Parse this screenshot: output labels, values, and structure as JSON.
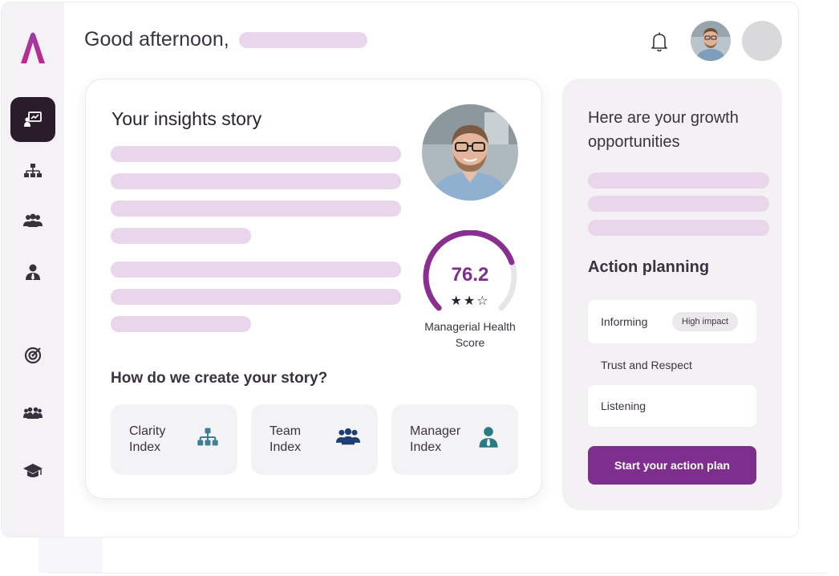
{
  "header": {
    "greeting": "Good afternoon,"
  },
  "nav": {
    "items": [
      {
        "icon": "dashboard-presentation-icon",
        "active": true
      },
      {
        "icon": "org-chart-icon",
        "active": false
      },
      {
        "icon": "team-icon",
        "active": false
      },
      {
        "icon": "manager-icon",
        "active": false
      },
      {
        "icon": "target-icon",
        "active": false
      },
      {
        "icon": "group-icon",
        "active": false
      },
      {
        "icon": "graduation-cap-icon",
        "active": false
      }
    ]
  },
  "insights": {
    "title": "Your insights story",
    "score_value": "76.2",
    "score_rating": 2,
    "score_rating_max": 3,
    "score_stars": "★★☆",
    "score_label": "Managerial Health Score",
    "score_fill_fraction": 0.762,
    "story_question": "How do we create your story?",
    "indices": [
      {
        "label": "Clarity Index",
        "icon": "org-chart-icon",
        "color": "#3f7f92"
      },
      {
        "label": "Team Index",
        "icon": "team-icon",
        "color": "#1f3f73"
      },
      {
        "label": "Manager Index",
        "icon": "manager-icon",
        "color": "#2b7c80"
      }
    ]
  },
  "growth": {
    "title": "Here are your growth opportunities",
    "action_title": "Action planning",
    "actions": [
      {
        "label": "Informing",
        "badge": "High impact"
      },
      {
        "label": "Trust and Respect"
      },
      {
        "label": "Listening"
      }
    ],
    "cta_label": "Start your action plan"
  },
  "colors": {
    "accent": "#7e2f8e",
    "placeholder": "#ead6ea",
    "sidebar_active": "#2b1c2c"
  }
}
